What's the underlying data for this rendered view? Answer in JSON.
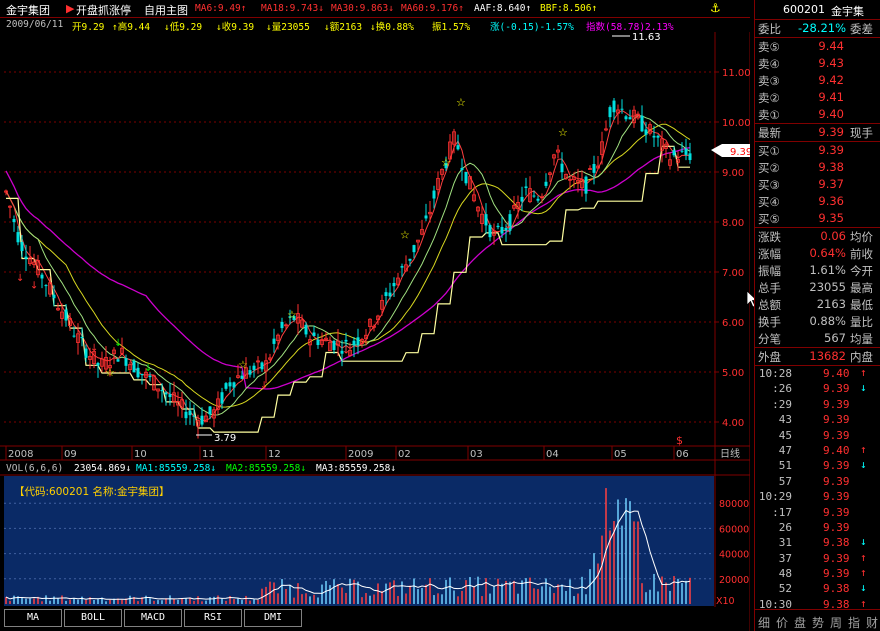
{
  "header": {
    "stock_name": "金宇集团",
    "title_name": "开盘抓涨停",
    "title_main": "自用主图",
    "ma": [
      {
        "label": "MA6:9.49↑",
        "color": "#ff3030"
      },
      {
        "label": "MA18:9.743↓",
        "color": "#ff3030"
      },
      {
        "label": "MA30:9.863↓",
        "color": "#ff3030"
      },
      {
        "label": "MA60:9.176↑",
        "color": "#ff3030"
      },
      {
        "label": "AAF:8.640↑",
        "color": "#ffffff"
      },
      {
        "label": "BBF:8.506↑",
        "color": "#ffff00"
      }
    ]
  },
  "info": {
    "date": "2009/06/11",
    "open": "开9.29",
    "high": "↑高9.44",
    "low": "↓低9.29",
    "close": "↓收9.39",
    "volume": "↓量23055",
    "amount": "↓额2163",
    "turnover": "↓换0.88%",
    "amplitude": "振1.57%",
    "change": "涨(-0.15)-1.57%",
    "index": "指数(58.78)2.13%"
  },
  "price_axis": {
    "labels": [
      "11.00",
      "10.00",
      "9.00",
      "8.00",
      "7.00",
      "6.00",
      "5.00",
      "4.00"
    ],
    "current": "9.39",
    "high_marker": "11.63",
    "low_marker": "3.79"
  },
  "date_axis": {
    "labels": [
      "2008",
      "09",
      "10",
      "11",
      "12",
      "2009",
      "02",
      "03",
      "04",
      "05",
      "06"
    ],
    "end_label": "日线",
    "dollar": "$"
  },
  "volume": {
    "header_label": "VOL(6,6,6)",
    "header_value": "23054.869↓",
    "ma1": "MA1:85559.258↓",
    "ma2": "MA2:85559.258↓",
    "ma3": "MA3:85559.258↓",
    "inner_label": "【代码:600201 名称:金宇集团】",
    "axis_labels": [
      "80000",
      "60000",
      "40000",
      "20000"
    ],
    "unit": "X10"
  },
  "tabs": [
    "MA",
    "BOLL",
    "MACD",
    "RSI",
    "DMI"
  ],
  "quote": {
    "code": "600201",
    "name": "金宇集",
    "weibi_label": "委比",
    "weibi_value": "-28.21%",
    "weicha_label": "委差",
    "sell": [
      {
        "label": "卖⑤",
        "price": "9.44"
      },
      {
        "label": "卖④",
        "price": "9.43"
      },
      {
        "label": "卖③",
        "price": "9.42"
      },
      {
        "label": "卖②",
        "price": "9.41"
      },
      {
        "label": "卖①",
        "price": "9.40"
      }
    ],
    "latest_label": "最新",
    "latest_value": "9.39",
    "latest_label2": "现手",
    "buy": [
      {
        "label": "买①",
        "price": "9.39"
      },
      {
        "label": "买②",
        "price": "9.38"
      },
      {
        "label": "买③",
        "price": "9.37"
      },
      {
        "label": "买④",
        "price": "9.36"
      },
      {
        "label": "买⑤",
        "price": "9.35"
      }
    ],
    "stats": [
      {
        "label": "涨跌",
        "value": "0.06",
        "label2": "均价",
        "color": "#ff3030"
      },
      {
        "label": "涨幅",
        "value": "0.64%",
        "label2": "前收",
        "color": "#ff3030"
      },
      {
        "label": "振幅",
        "value": "1.61%",
        "label2": "今开",
        "color": "#c0c0c0"
      },
      {
        "label": "总手",
        "value": "23055",
        "label2": "最高",
        "color": "#c0c0c0"
      },
      {
        "label": "总额",
        "value": "2163",
        "label2": "最低",
        "color": "#c0c0c0"
      },
      {
        "label": "换手",
        "value": "0.88%",
        "label2": "量比",
        "color": "#c0c0c0"
      },
      {
        "label": "分笔",
        "value": "567",
        "label2": "均量",
        "color": "#c0c0c0"
      }
    ],
    "outer_label": "外盘",
    "outer_value": "13682",
    "inner_label2": "内盘",
    "ticks": [
      {
        "time": "10:28",
        "price": "9.40",
        "arrow": "↑",
        "up": true
      },
      {
        "time": ":26",
        "price": "9.39",
        "arrow": "↓",
        "up": false
      },
      {
        "time": ":29",
        "price": "9.39",
        "arrow": "",
        "up": false
      },
      {
        "time": "43",
        "price": "9.39",
        "arrow": "",
        "up": false
      },
      {
        "time": "45",
        "price": "9.39",
        "arrow": "",
        "up": false
      },
      {
        "time": "47",
        "price": "9.40",
        "arrow": "↑",
        "up": true
      },
      {
        "time": "51",
        "price": "9.39",
        "arrow": "↓",
        "up": false
      },
      {
        "time": "57",
        "price": "9.39",
        "arrow": "",
        "up": false
      },
      {
        "time": "10:29",
        "price": "9.39",
        "arrow": "",
        "up": false
      },
      {
        "time": ":17",
        "price": "9.39",
        "arrow": "",
        "up": false
      },
      {
        "time": "26",
        "price": "9.39",
        "arrow": "",
        "up": false
      },
      {
        "time": "31",
        "price": "9.38",
        "arrow": "↓",
        "up": false
      },
      {
        "time": "37",
        "price": "9.39",
        "arrow": "↑",
        "up": true
      },
      {
        "time": "48",
        "price": "9.39",
        "arrow": "↑",
        "up": true
      },
      {
        "time": "52",
        "price": "9.38",
        "arrow": "↓",
        "up": false
      },
      {
        "time": "10:30",
        "price": "9.38",
        "arrow": "↑",
        "up": true
      }
    ],
    "footer": [
      "细",
      "价",
      "盘",
      "势",
      "周",
      "指",
      "财"
    ]
  }
}
